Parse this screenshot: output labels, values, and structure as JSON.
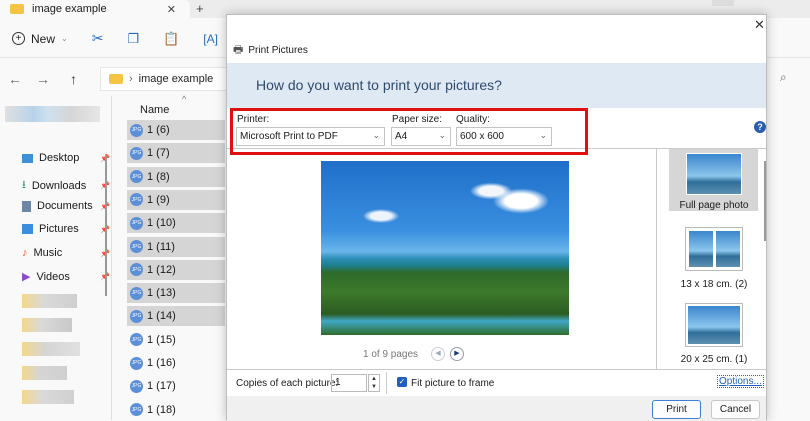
{
  "explorer": {
    "tab_title": "image example",
    "new_tab": "+",
    "toolbar": {
      "new_label": "New"
    },
    "address": {
      "path": "image example"
    },
    "nav": [
      {
        "label": "Desktop",
        "icon": "desktop-icon"
      },
      {
        "label": "Downloads",
        "icon": "download-icon"
      },
      {
        "label": "Documents",
        "icon": "documents-icon"
      },
      {
        "label": "Pictures",
        "icon": "pictures-icon"
      },
      {
        "label": "Music",
        "icon": "music-icon"
      },
      {
        "label": "Videos",
        "icon": "videos-icon"
      }
    ],
    "column_name": "Name",
    "files": [
      {
        "name": "1 (6)",
        "selected": true
      },
      {
        "name": "1 (7)",
        "selected": true
      },
      {
        "name": "1 (8)",
        "selected": true
      },
      {
        "name": "1 (9)",
        "selected": true
      },
      {
        "name": "1 (10)",
        "selected": true
      },
      {
        "name": "1 (11)",
        "selected": true
      },
      {
        "name": "1 (12)",
        "selected": true
      },
      {
        "name": "1 (13)",
        "selected": true
      },
      {
        "name": "1 (14)",
        "selected": true
      },
      {
        "name": "1 (15)",
        "selected": false
      },
      {
        "name": "1 (16)",
        "selected": false
      },
      {
        "name": "1 (17)",
        "selected": false
      },
      {
        "name": "1 (18)",
        "selected": false
      }
    ]
  },
  "dialog": {
    "title": "Print Pictures",
    "question": "How do you want to print your pictures?",
    "printer_label": "Printer:",
    "printer_value": "Microsoft Print to PDF",
    "paper_label": "Paper size:",
    "paper_value": "A4",
    "quality_label": "Quality:",
    "quality_value": "600 x 600",
    "page_indicator": "1 of 9 pages",
    "layouts": [
      {
        "label": "Full page photo",
        "selected": true
      },
      {
        "label": "13 x 18 cm. (2)",
        "selected": false
      },
      {
        "label": "20 x 25 cm. (1)",
        "selected": false
      }
    ],
    "copies_label": "Copies of each picture:",
    "copies_value": "1",
    "fit_label": "Fit picture to frame",
    "fit_checked": true,
    "options_link": "Options...",
    "print_button": "Print",
    "cancel_button": "Cancel",
    "highlight_color": "#e01010"
  }
}
